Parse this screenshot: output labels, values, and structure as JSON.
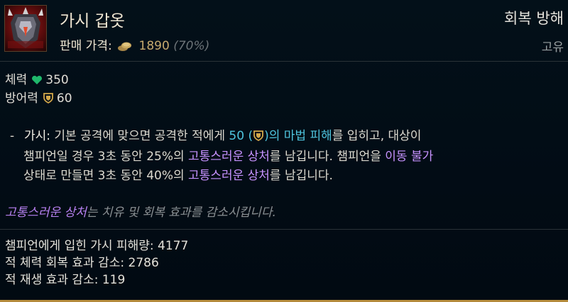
{
  "item": {
    "name": "가시 갑옷",
    "icon": "thornmail-armor-icon",
    "price_label": "판매 가격:",
    "price": "1890",
    "price_pct": "(70%)",
    "category": "회복 방해",
    "rarity": "고유"
  },
  "stats": [
    {
      "label": "체력",
      "icon": "heart-icon",
      "value": "350"
    },
    {
      "label": "방어력",
      "icon": "armor-shield-icon",
      "value": "60"
    }
  ],
  "passive": {
    "bullet": "-",
    "name": "가시",
    "colon": ":",
    "line1_text": " 기본 공격에 맞으면 공격한 적에게 ",
    "damage_value": "50 (",
    "damage_close": ")",
    "damage_type": "의 마법 피해",
    "line1_end": "를 입히고, 대상이",
    "line2_text": "챔피언일 경우 3초 동안 25%의 ",
    "keyword_grievous": "고통스러운 상처",
    "line2_mid": "를 남깁니다. 챔피언을 ",
    "keyword_immobilize": "이동 불가",
    "line3_text": "상태로 만들면 3초 동안 40%의 ",
    "line3_end": "를 남깁니다.",
    "colors": {
      "damage": "#4fc4dd",
      "keyword": "#c792ff"
    }
  },
  "keyword_note": {
    "keyword": "고통스러운 상처",
    "text": "는 치유 및 회복 효과를 감소시킵니다."
  },
  "counters": [
    "챔피언에게 입힌 가시 피해량: 4177",
    "적 체력 회복 효과 감소: 2786",
    "적 재생 효과 감소: 119"
  ]
}
